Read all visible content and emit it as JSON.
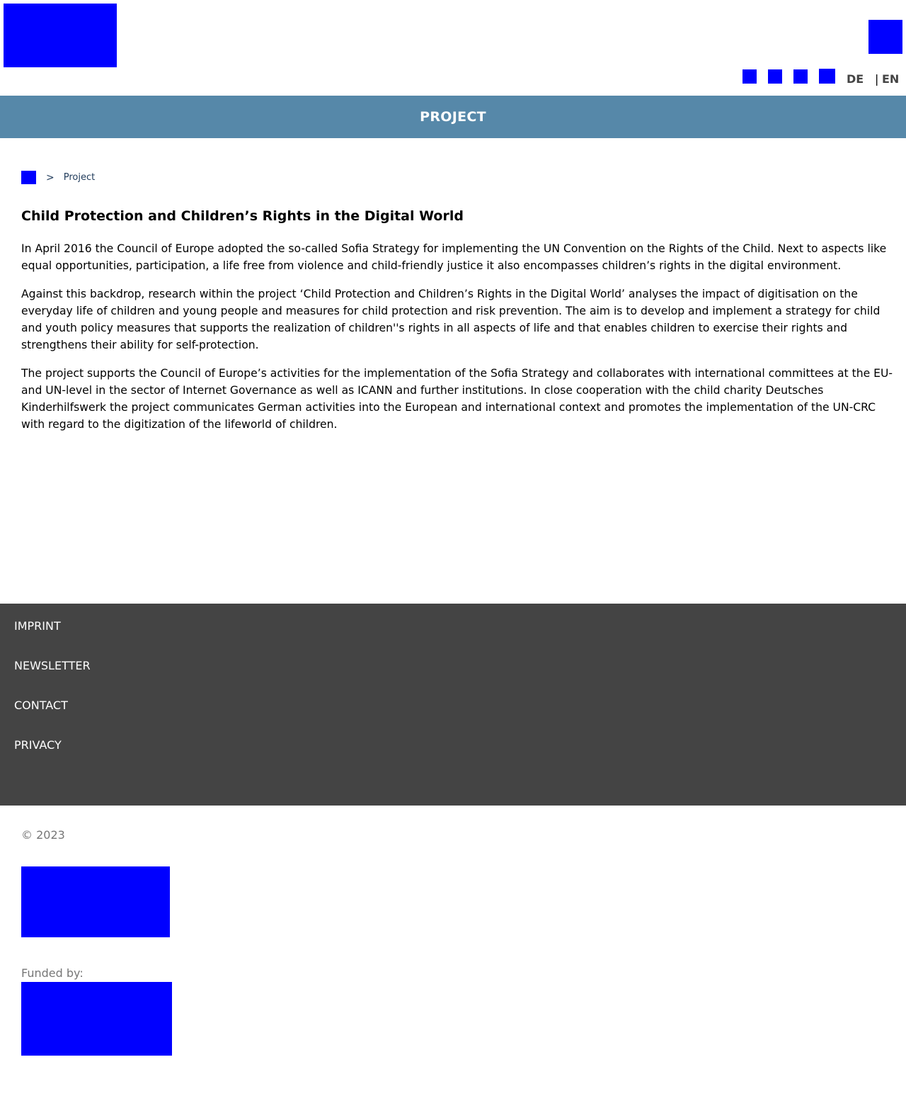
{
  "header": {
    "logo_icon": "site-logo",
    "menu_icon": "menu-icon",
    "social_icons": [
      "social-icon-1",
      "social-icon-2",
      "social-icon-3",
      "social-icon-4"
    ],
    "lang_de": "DE",
    "lang_separator": "|",
    "lang_en": "EN"
  },
  "banner": {
    "title": "PROJECT"
  },
  "breadcrumb": {
    "home_icon": "home-icon",
    "separator": ">",
    "current": "Project"
  },
  "main": {
    "title": "Child Protection and Children’s Rights in the Digital World",
    "paragraphs": [
      "In April 2016 the Council of Europe adopted the so-called Sofia Strategy for implementing the UN Convention on the Rights of the Child. Next to aspects like equal opportunities, participation, a life free from violence and child-friendly justice it also encompasses children’s rights in the digital environment.",
      "Against this backdrop, research within the project ‘Child Protection and Children’s Rights in the Digital World’ analyses the impact of digitisation on the everyday life of children and young people and measures for child protection and risk prevention. The aim is to develop and implement a strategy for child and youth policy measures that supports the realization of children''s rights in all aspects of life and that enables children to exercise their rights and strengthens their ability for self-protection.",
      "The project supports the Council of Europe’s activities for the implementation of the Sofia Strategy and collaborates with international committees at the EU- and UN-level in the sector of Internet Governance as well as ICANN and further institutions. In close cooperation with the child charity Deutsches Kinderhilfswerk the project communicates German activities into the European and international context and promotes the implementation of the UN-CRC with regard to the digitization of the lifeworld of children."
    ]
  },
  "footer": {
    "links": [
      "IMPRINT",
      "NEWSLETTER",
      "CONTACT",
      "PRIVACY"
    ],
    "copyright": "© 2023",
    "funded_by": "Funded by:"
  },
  "colors": {
    "banner": "#5688a9",
    "footer": "#444444",
    "image_placeholder": "#0000ff"
  }
}
